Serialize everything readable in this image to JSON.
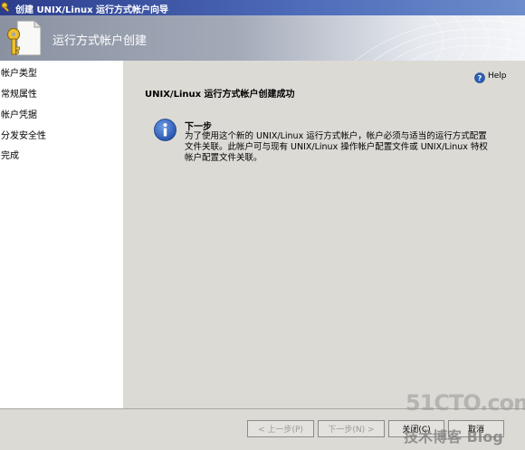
{
  "window": {
    "title": "创建 UNIX/Linux 运行方式帐户向导",
    "title_icon": "key-icon"
  },
  "header": {
    "title": "运行方式帐户创建",
    "icon": "key-document-icon"
  },
  "nav": {
    "items": [
      {
        "label": "帐户类型"
      },
      {
        "label": "常规属性"
      },
      {
        "label": "帐户凭据"
      },
      {
        "label": "分发安全性"
      },
      {
        "label": "完成"
      }
    ]
  },
  "main": {
    "help_label": "Help",
    "heading": "UNIX/Linux 运行方式帐户创建成功",
    "next_step_title": "下一步",
    "next_step_body": "为了使用这个新的 UNIX/Linux 运行方式帐户，帐户必须与适当的运行方式配置文件关联。此帐户可与现有 UNIX/Linux 操作帐户配置文件或 UNIX/Linux 特权帐户配置文件关联。"
  },
  "footer": {
    "prev_label": "< 上一步(P)",
    "next_label": "下一步(N) >",
    "finish_label": "关闭(C)",
    "cancel_label": "取消"
  },
  "watermark": {
    "line1": "51CTO.com",
    "line2": "技术博客 Blog"
  },
  "colors": {
    "title_bar": "#2c3d8c",
    "panel": "#dcdad5",
    "info_blue": "#1f4fa8"
  }
}
